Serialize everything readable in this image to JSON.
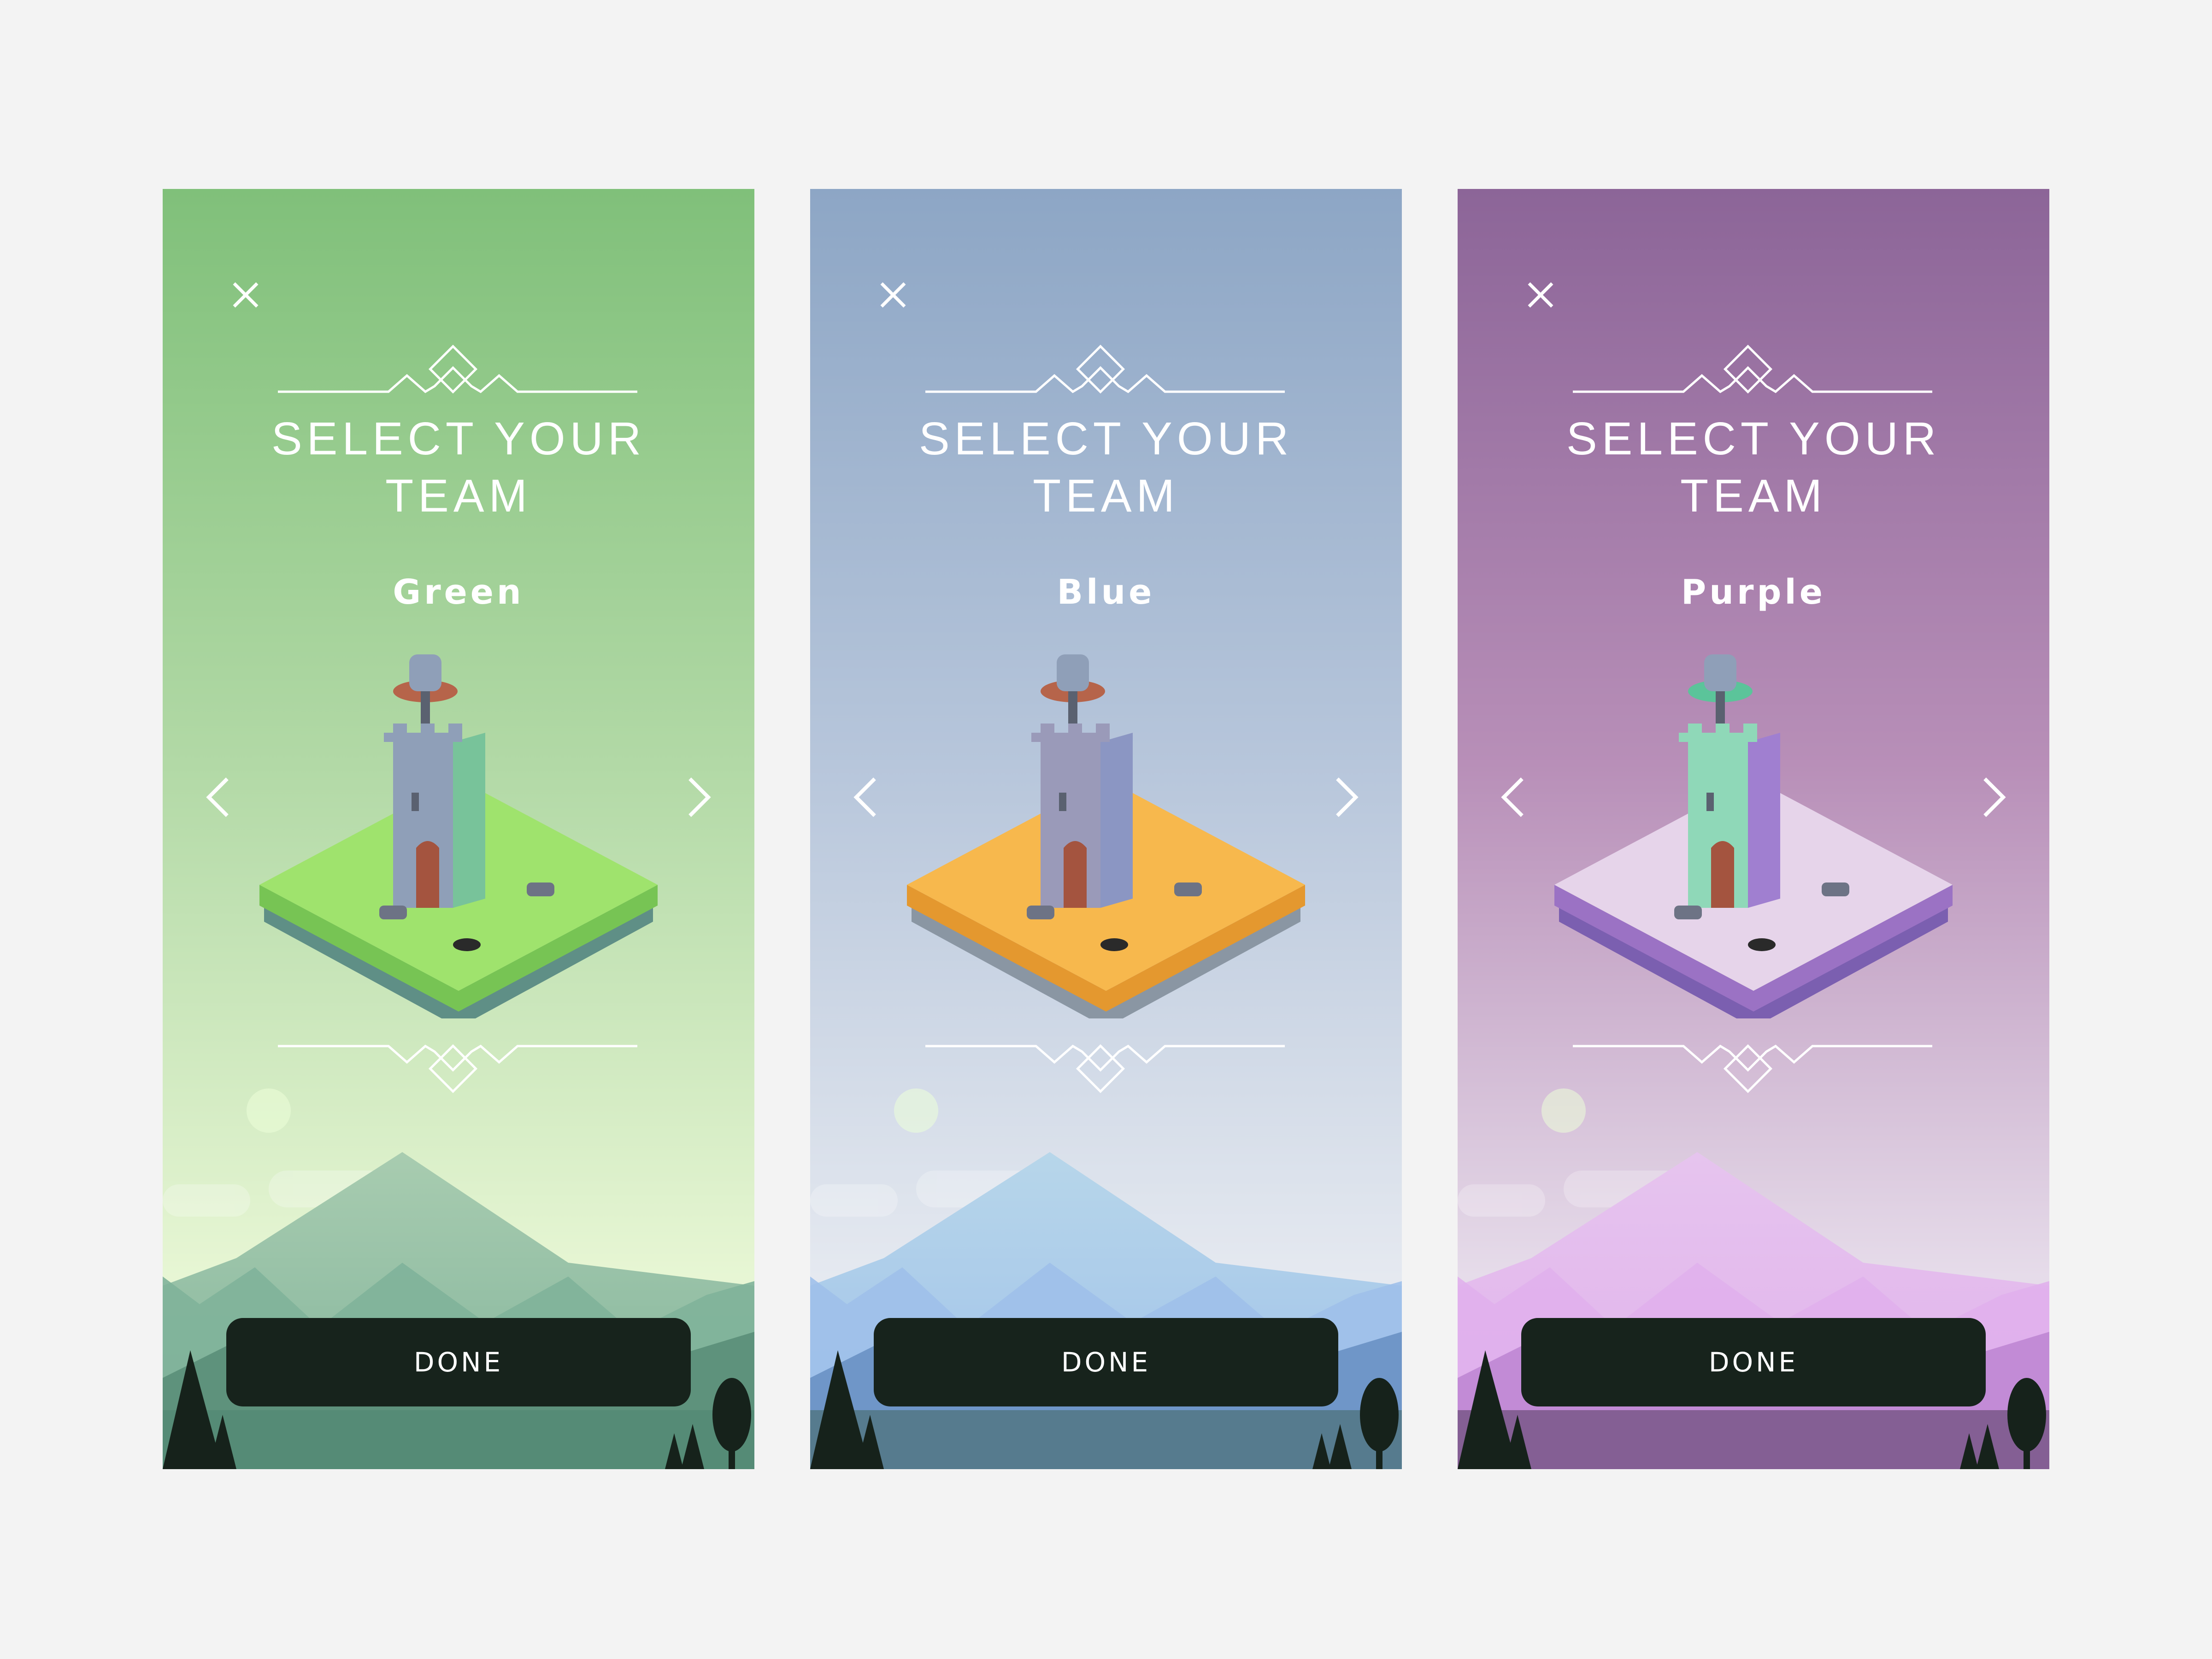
{
  "screens": [
    {
      "id": "green",
      "title_line1": "SELECT YOUR",
      "title_line2": "TEAM",
      "team_name": "Green",
      "done_label": "DONE",
      "close_icon": "close-icon",
      "prev_icon": "chevron-left-icon",
      "next_icon": "chevron-right-icon",
      "colors": {
        "sky_top": "#80c07a",
        "sky_mid": "#b2d9a6",
        "sky_bottom": "#e7f6d4",
        "mountain": "#a8ccb0",
        "mountain_mid": "#80b29a",
        "mountain_dark": "#5e927c",
        "ground": "#558b76",
        "platform_top": "#9fe36d",
        "platform_side": "#77c454",
        "platform_base": "#5f8f86",
        "tower": "#8f9fb8",
        "banner": "#78c39a",
        "roof": "#b6644a"
      }
    },
    {
      "id": "blue",
      "title_line1": "SELECT YOUR",
      "title_line2": "TEAM",
      "team_name": "Blue",
      "done_label": "DONE",
      "close_icon": "close-icon",
      "prev_icon": "chevron-left-icon",
      "next_icon": "chevron-right-icon",
      "colors": {
        "sky_top": "#8da6c5",
        "sky_mid": "#b7c6db",
        "sky_bottom": "#e5e9f0",
        "mountain": "#b7d6ea",
        "mountain_mid": "#9ec0ea",
        "mountain_dark": "#6f96c8",
        "ground": "#567b8e",
        "platform_top": "#f7b84d",
        "platform_side": "#e4982f",
        "platform_base": "#8a96a3",
        "tower": "#9a9ab9",
        "banner": "#8b96c3",
        "roof": "#b6644a"
      }
    },
    {
      "id": "purple",
      "title_line1": "SELECT YOUR",
      "title_line2": "TEAM",
      "team_name": "Purple",
      "done_label": "DONE",
      "close_icon": "close-icon",
      "prev_icon": "chevron-left-icon",
      "next_icon": "chevron-right-icon",
      "colors": {
        "sky_top": "#8c6598",
        "sky_mid": "#b88fb8",
        "sky_bottom": "#e6dcea",
        "mountain": "#e6c4ee",
        "mountain_mid": "#e0b0ec",
        "mountain_dark": "#c28bd6",
        "ground": "#845f94",
        "platform_top": "#e6d4ea",
        "platform_side": "#9b72c4",
        "platform_base": "#7b5fb0",
        "tower": "#8fd8b8",
        "banner": "#a07fd0",
        "roof": "#5bc49a"
      }
    }
  ]
}
